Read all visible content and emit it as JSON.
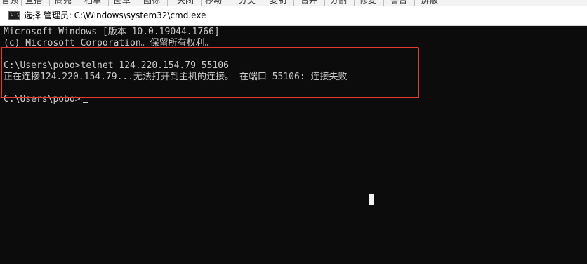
{
  "background_toolbar": {
    "items": [
      "音频",
      "直播",
      "高亮",
      "稻草",
      "图章",
      "图标",
      "关闭",
      "移动",
      "分类",
      "复制",
      "合并",
      "分割",
      "修复",
      "警告",
      "屏蔽"
    ]
  },
  "window": {
    "title": "选择 管理员: C:\\Windows\\system32\\cmd.exe",
    "icon": "cmd-console-icon",
    "icon_glyph": "C:\\"
  },
  "console": {
    "lines": [
      "Microsoft Windows [版本 10.0.19044.1766]",
      "(c) Microsoft Corporation。保留所有权利。",
      "",
      "C:\\Users\\pobo>telnet 124.220.154.79 55106",
      "正在连接124.220.154.79...无法打开到主机的连接。 在端口 55106: 连接失败",
      "",
      "C:\\Users\\pobo>"
    ]
  },
  "colors": {
    "console_bg": "#0c0c0c",
    "console_text": "#cccccc",
    "highlight_box": "#e53935",
    "titlebar_bg": "#ffffff"
  }
}
